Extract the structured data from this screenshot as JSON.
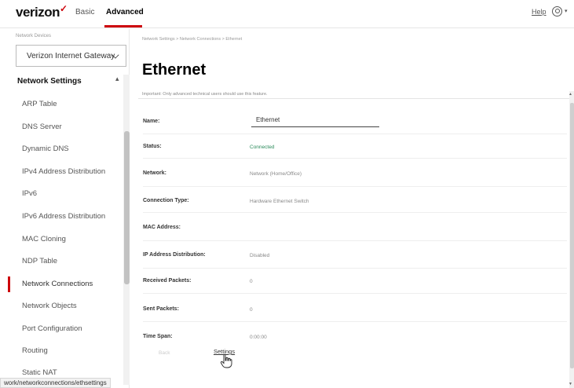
{
  "header": {
    "logo": "verizon",
    "logo_mark": "✓",
    "tabs": [
      "Basic",
      "Advanced"
    ],
    "active_tab": "Advanced",
    "help": "Help",
    "user_caret": "▾"
  },
  "sidebar": {
    "gateway_label": "Network Devices",
    "gateway_selected": "Verizon Internet Gateway",
    "section_title": "Network Settings",
    "section_caret": "▴",
    "items": [
      "ARP Table",
      "DNS Server",
      "Dynamic DNS",
      "IPv4 Address Distribution",
      "IPv6",
      "IPv6 Address Distribution",
      "MAC Cloning",
      "NDP Table",
      "Network Connections",
      "Network Objects",
      "Port Configuration",
      "Routing",
      "Static NAT"
    ],
    "active_item": "Network Connections"
  },
  "status_url": "work/networkconnections/ethsettings",
  "main": {
    "breadcrumb": "Network Settings  >  Network Connections  >  Ethernet",
    "title": "Ethernet",
    "notice": "Important: Only advanced technical users should use this feature.",
    "fields": [
      {
        "label": "Name:",
        "value": "Ethernet"
      },
      {
        "label": "Status:",
        "value": "Connected"
      },
      {
        "label": "Network:",
        "value": "Network (Home/Office)"
      },
      {
        "label": "Connection Type:",
        "value": "Hardware Ethernet Switch"
      },
      {
        "label": "MAC Address:",
        "value": ""
      },
      {
        "label": "IP Address Distribution:",
        "value": "Disabled"
      },
      {
        "label": "Received Packets:",
        "value": "0"
      },
      {
        "label": "Sent Packets:",
        "value": "0"
      },
      {
        "label": "Time Span:",
        "value": "0:00:00"
      }
    ],
    "status_color": "#2a8a5a",
    "buttons": {
      "left": "Back",
      "settings": "Settings"
    }
  },
  "colors": {
    "brand_red": "#cd040b"
  }
}
